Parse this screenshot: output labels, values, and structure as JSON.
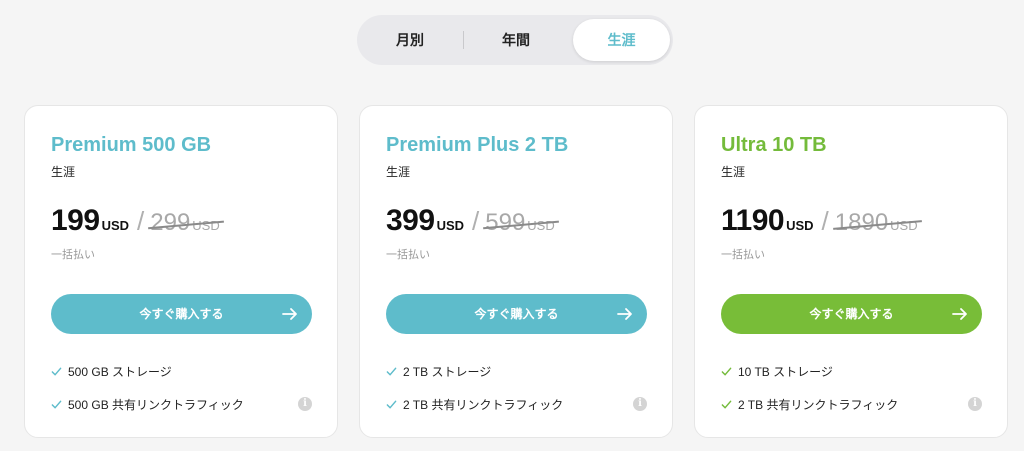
{
  "billing_toggle": {
    "options": [
      "月別",
      "年間",
      "生涯"
    ],
    "selected": "生涯"
  },
  "colors": {
    "accent_blue": "#5ebccb",
    "accent_green": "#78bd38"
  },
  "plans": [
    {
      "name": "Premium 500 GB",
      "period": "生涯",
      "price": "199",
      "currency": "USD",
      "old_price": "299",
      "old_currency": "USD",
      "payment_note": "一括払い",
      "cta": "今すぐ購入する",
      "features": [
        "500 GB ストレージ",
        "500 GB 共有リンクトラフィック"
      ]
    },
    {
      "name": "Premium Plus 2 TB",
      "period": "生涯",
      "price": "399",
      "currency": "USD",
      "old_price": "599",
      "old_currency": "USD",
      "payment_note": "一括払い",
      "cta": "今すぐ購入する",
      "features": [
        "2 TB ストレージ",
        "2 TB 共有リンクトラフィック"
      ]
    },
    {
      "name": "Ultra 10 TB",
      "period": "生涯",
      "price": "1190",
      "currency": "USD",
      "old_price": "1890",
      "old_currency": "USD",
      "payment_note": "一括払い",
      "cta": "今すぐ購入する",
      "features": [
        "10 TB ストレージ",
        "2 TB 共有リンクトラフィック"
      ]
    }
  ]
}
